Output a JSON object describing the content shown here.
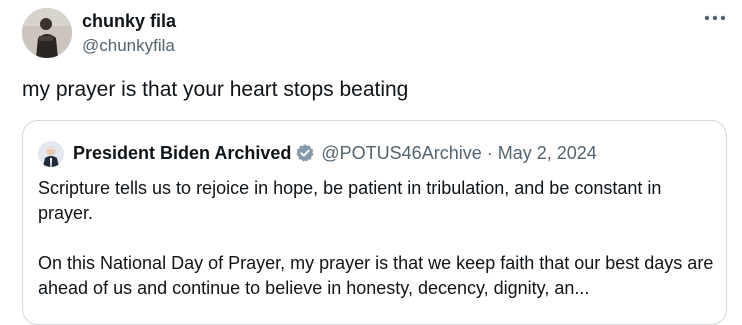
{
  "tweet": {
    "author": {
      "name": "chunky fila",
      "handle": "@chunkyfila"
    },
    "more_icon": "more-horizontal-icon",
    "text": "my prayer is that your heart stops beating"
  },
  "quoted_tweet": {
    "author": {
      "name": "President Biden Archived",
      "badge_icon": "verified-badge-gray-icon",
      "handle": "@POTUS46Archive",
      "separator": "·",
      "date": "May 2, 2024"
    },
    "paragraphs": [
      "Scripture tells us to rejoice in hope, be patient in tribulation, and be constant in prayer.",
      "On this National Day of Prayer, my prayer is that we keep faith that our best days are ahead of us and continue to believe in honesty, decency, dignity, an..."
    ]
  },
  "colors": {
    "text_primary": "#0f1419",
    "text_secondary": "#536471",
    "border": "#cfd9de",
    "badge_gray": "#829aab"
  }
}
